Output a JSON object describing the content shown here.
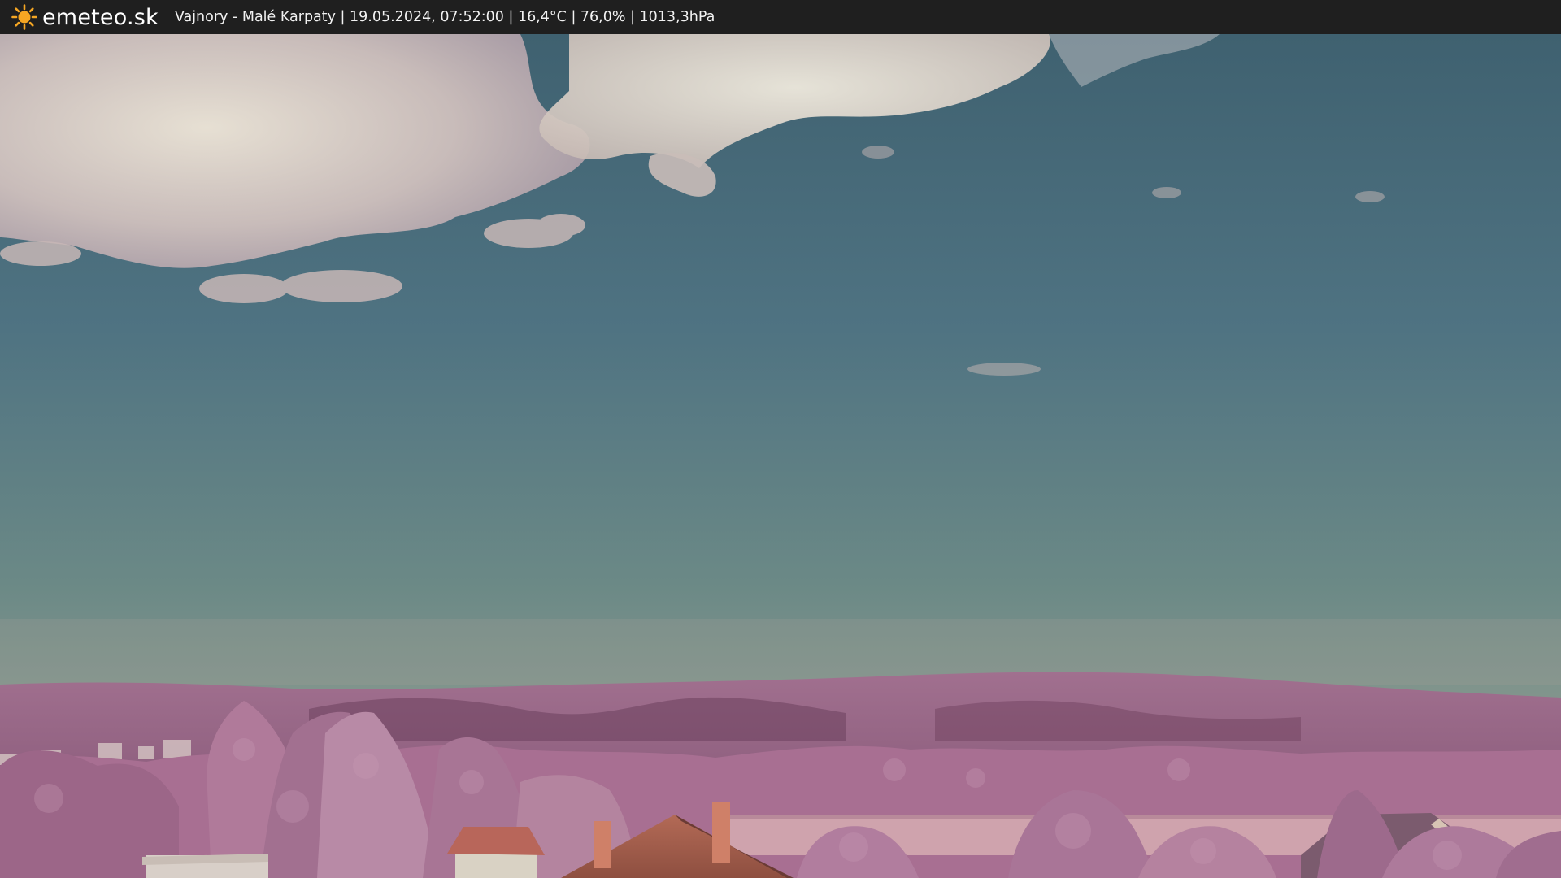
{
  "header": {
    "site_name": "emeteo.sk",
    "logo_icon": "sun-icon",
    "caption": "Vajnory - Malé Karpaty | 19.05.2024, 07:52:00 | 16,4°C | 76,0% | 1013,3hPa"
  },
  "colors": {
    "bar": "#1f1f1f",
    "sun": "#f5a623",
    "sky_top": "#4c6e7f",
    "sky_bottom": "#8a9a8f",
    "foliage": "#b27a9a"
  }
}
